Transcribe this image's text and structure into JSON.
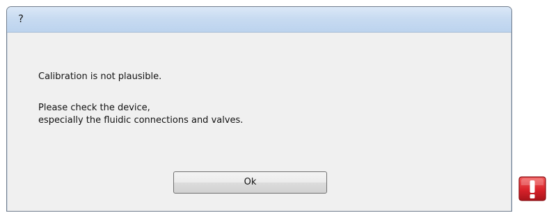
{
  "window": {
    "title": "?"
  },
  "message": {
    "line1": "Calibration is not plausible.",
    "line2": "Please check the device,",
    "line3": "especially the fluidic connections and valves."
  },
  "buttons": {
    "ok_label": "Ok"
  },
  "icons": {
    "warning": "warning-exclamation-icon"
  },
  "colors": {
    "titlebar": "#c8dbf1",
    "dialog_background": "#f0f0f0",
    "warning_red": "#d8222a"
  }
}
